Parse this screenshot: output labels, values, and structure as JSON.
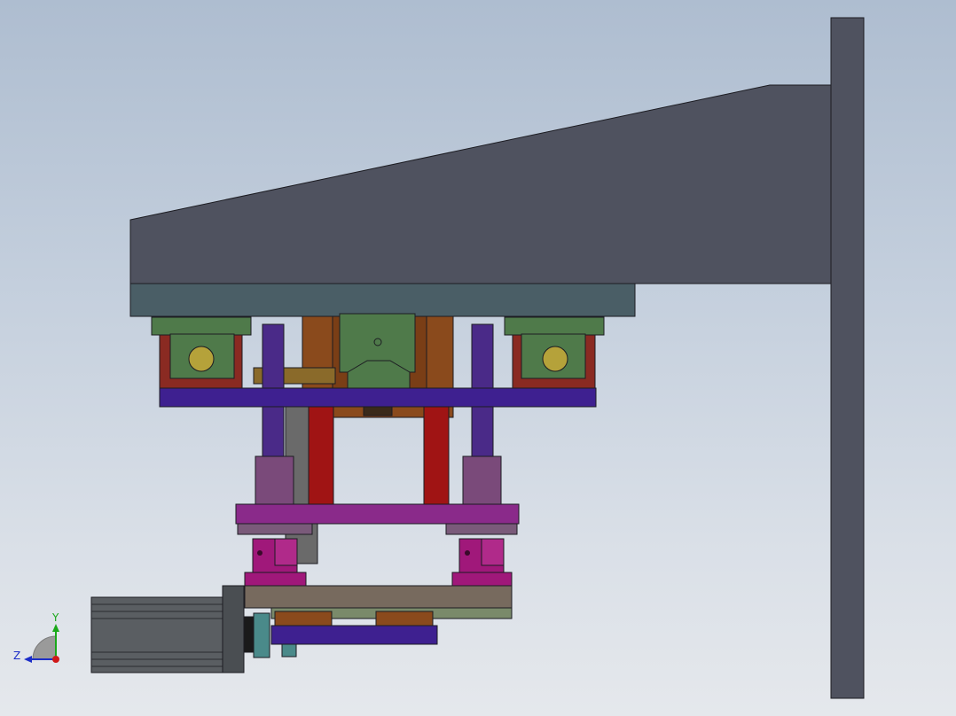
{
  "triad": {
    "y_label": "Y",
    "z_label": "Z",
    "colors": {
      "y": "#1aa81a",
      "z": "#1c2ec8",
      "x": "#d01818"
    }
  },
  "colors": {
    "frame": "#4f525f",
    "mounting_plate": "#4a5e66",
    "rail_block_green": "#4f7a4a",
    "rail_bracket_red": "#8a2a22",
    "carriage_orange": "#8a4a1c",
    "guide_rod_violet": "#4a2a88",
    "plate_indigo": "#3e2090",
    "column_red": "#a01414",
    "plate_magenta": "#8a2a8a",
    "clamp_magenta": "#a0187a",
    "base_plate_tan": "#776a5e",
    "motor_gray": "#5a5e62",
    "coupling_teal": "#4a8a8a"
  }
}
